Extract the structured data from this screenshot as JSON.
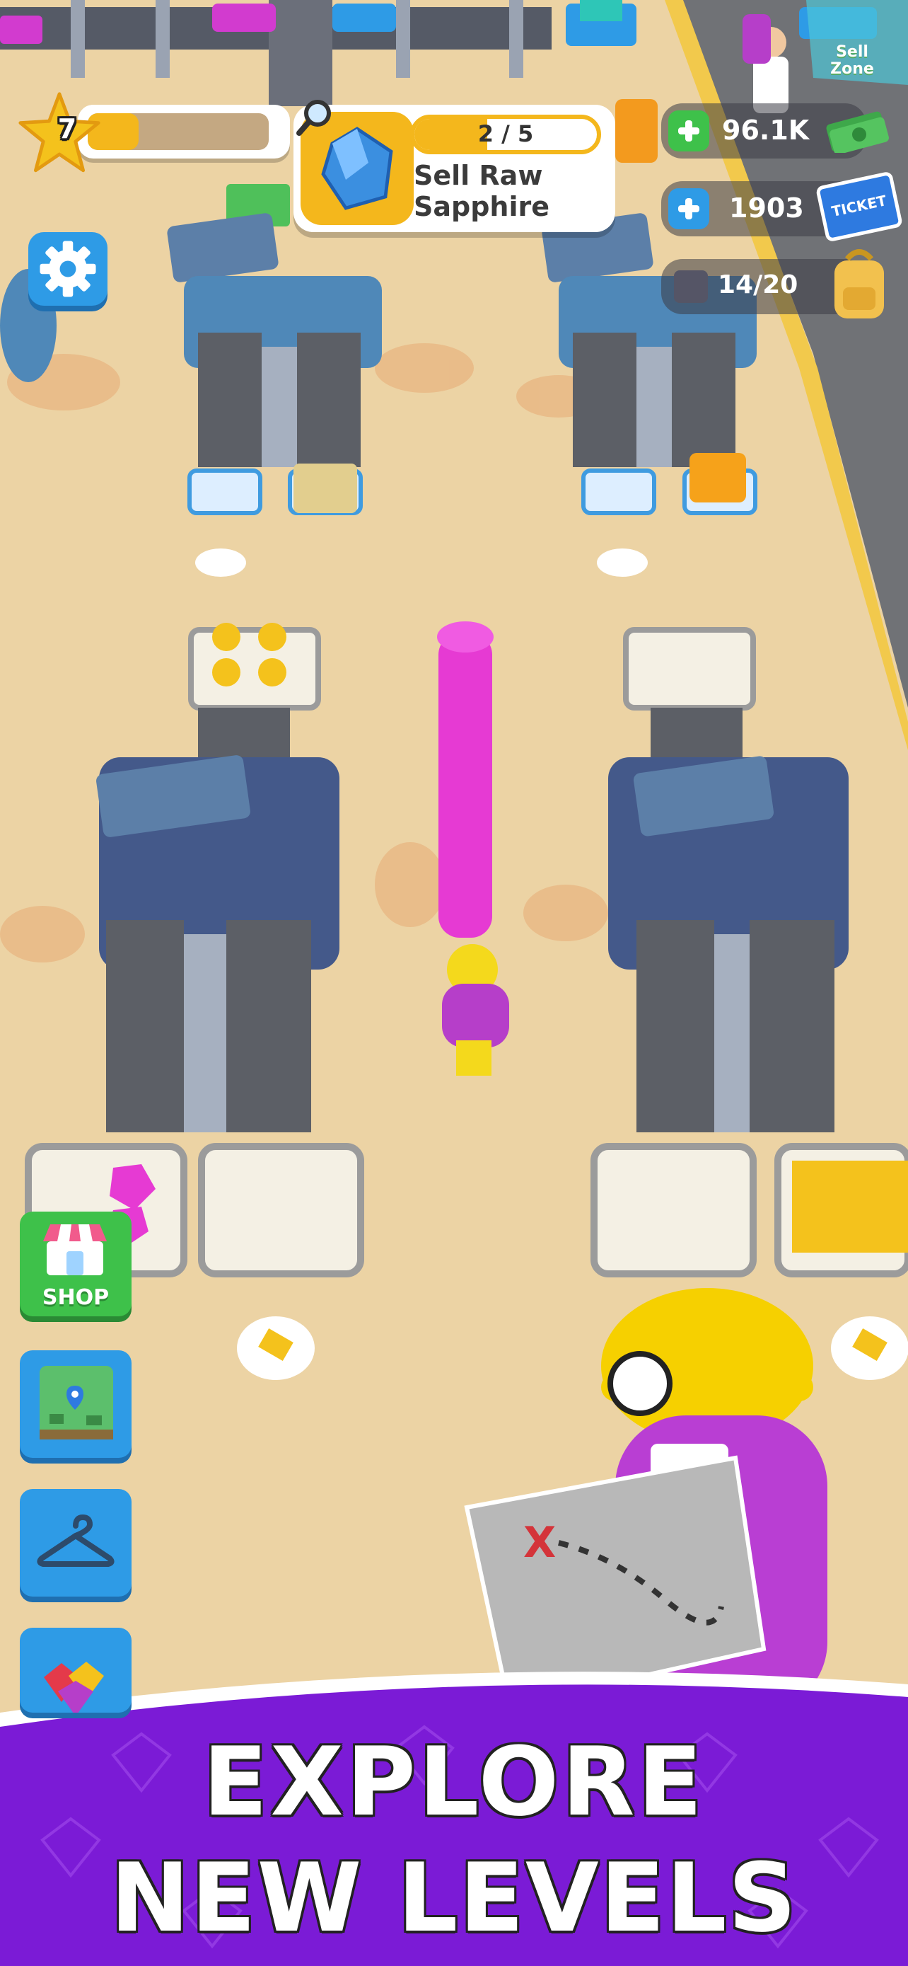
{
  "hud": {
    "level": "7",
    "level_progress": 0.28,
    "quest": {
      "progress": "2 / 5",
      "progress_fraction": 0.4,
      "title_line1": "Sell Raw",
      "title_line2": "Sapphire"
    },
    "cash": "96.1K",
    "tickets": "1903",
    "ticket_label": "TICKET",
    "capacity": "14/20",
    "sell_zone": "Sell Zone"
  },
  "sidebar": {
    "shop_label": "SHOP",
    "buttons": [
      "shop",
      "map",
      "wardrobe",
      "gems"
    ]
  },
  "banner": {
    "line1": "EXPLORE",
    "line2": "NEW LEVELS",
    "color": "#7b1bd6"
  },
  "colors": {
    "ground": "#e9cd9c",
    "road": "#6e6f73",
    "machine": "#4d6aa0",
    "accent_blue": "#2e9be6",
    "gold": "#f4c21c",
    "green": "#3ec14a"
  }
}
